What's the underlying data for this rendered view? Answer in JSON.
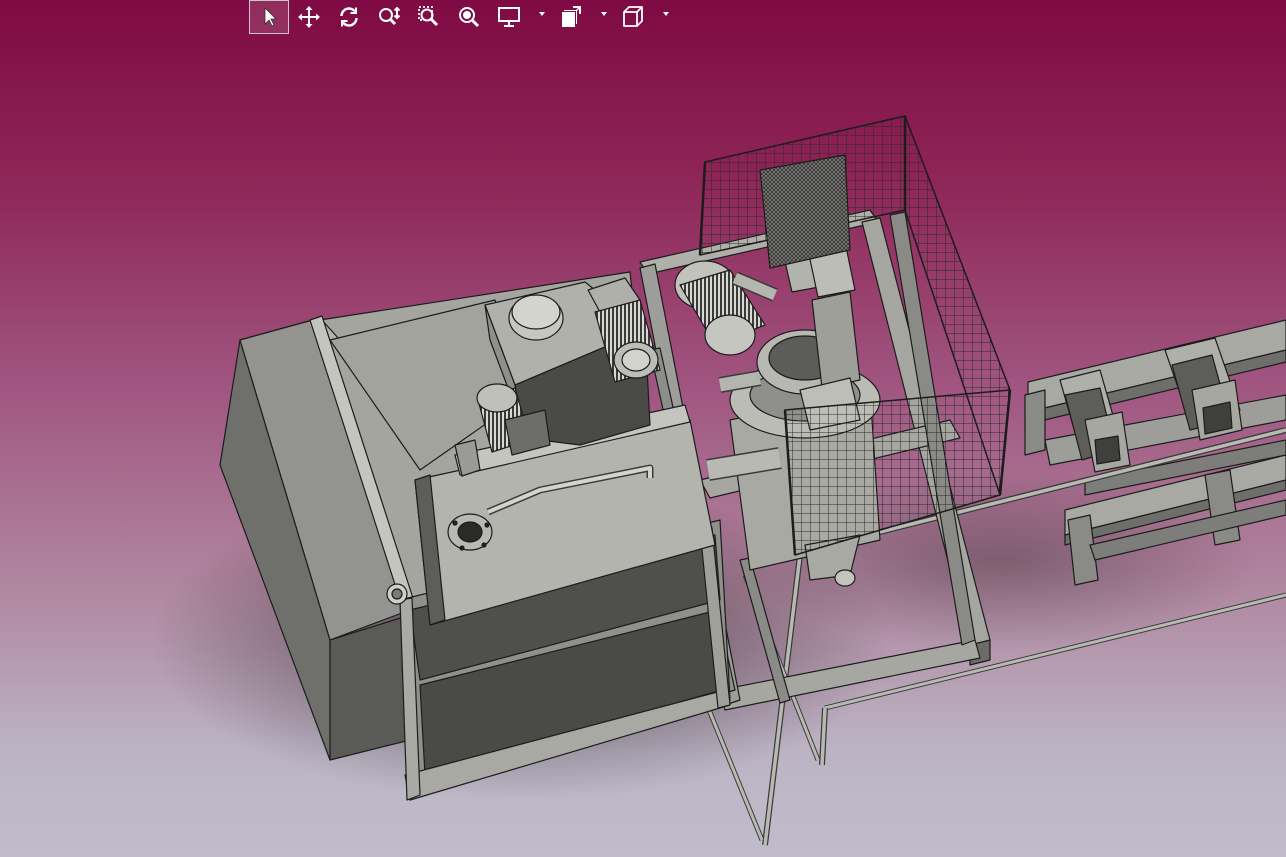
{
  "app": {
    "window": "3d-cad-viewer",
    "background_top": "#7f0a43",
    "background_bottom": "#c0bccb",
    "model_fill": "#a8a8a3",
    "model_dark": "#4a4a47",
    "edge_color": "#1c1c1c"
  },
  "toolbar": {
    "items": [
      {
        "name": "select-tool",
        "icon": "cursor-arrow-icon",
        "active": true
      },
      {
        "name": "pan-tool",
        "icon": "move-arrows-icon",
        "active": false
      },
      {
        "name": "rotate-tool",
        "icon": "rotate-icon",
        "active": false
      },
      {
        "name": "zoom-tool",
        "icon": "zoom-updown-icon",
        "active": false
      },
      {
        "name": "zoom-window-tool",
        "icon": "zoom-window-icon",
        "active": false
      },
      {
        "name": "zoom-fit-tool",
        "icon": "zoom-fit-icon",
        "active": false
      },
      {
        "name": "display-mode-menu",
        "icon": "monitor-icon",
        "has_dropdown": true
      },
      {
        "name": "view-options-menu",
        "icon": "views-icon",
        "has_dropdown": true
      },
      {
        "name": "standard-views-menu",
        "icon": "cube-icon",
        "has_dropdown": true
      }
    ]
  }
}
